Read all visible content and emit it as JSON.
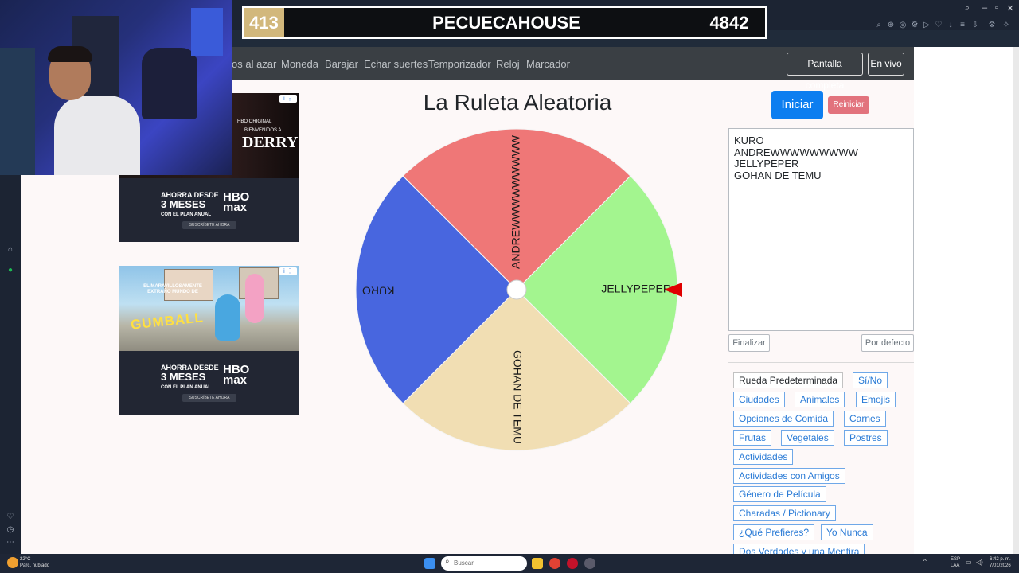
{
  "stream": {
    "score_left": "413",
    "channel_name": "PECUECAHOUSE",
    "score_right": "4842"
  },
  "nav": {
    "links": [
      "os al azar",
      "Moneda",
      "Barajar",
      "Echar suertes",
      "Temporizador",
      "Reloj",
      "Marcador"
    ],
    "fullscreen_label": "Pantalla completa",
    "live_label": "En vivo"
  },
  "main": {
    "title": "La Ruleta Aleatoria",
    "start_label": "Iniciar",
    "reset_label": "Reiniciar",
    "entries": [
      "KURO",
      "ANDREWWWWWWWWW",
      "JELLYPEPER",
      "GOHAN DE TEMU"
    ],
    "finish_label": "Finalizar",
    "default_label": "Por defecto"
  },
  "wheel": {
    "segments": [
      {
        "label": "ANDREWWWWWWWWW",
        "color": "#ef7777"
      },
      {
        "label": "JELLYPEPER",
        "color": "#a3f58f"
      },
      {
        "label": "GOHAN DE TEMU",
        "color": "#f1deb3"
      },
      {
        "label": "KURO",
        "color": "#4866df"
      }
    ],
    "pointer_color": "#e00000"
  },
  "presets": [
    "Rueda Predeterminada",
    "Sí/No",
    "Ciudades",
    "Animales",
    "Emojis",
    "Opciones de Comida",
    "Carnes",
    "Frutas",
    "Vegetales",
    "Postres",
    "Actividades",
    "Actividades con Amigos",
    "Género de Película",
    "Charadas / Pictionary",
    "¿Qué Prefieres?",
    "Yo Nunca",
    "Dos Verdades y una Mentira"
  ],
  "ads": {
    "hbo_original": "HBO ORIGINAL",
    "derry_line1": "BIENVENIDOS A",
    "derry_title": "DERRY",
    "gumball_line": "EL MARAVILLOSAMENTE EXTRAÑO MUNDO DE",
    "gumball_title": "GUMBALL",
    "promo_line1": "AHORRA DESDE",
    "promo_line2": "3 MESES",
    "promo_line3": "CON EL PLAN ANUAL",
    "promo_logo_top": "HBO",
    "promo_logo_bottom": "max",
    "promo_cta": "SUSCRÍBETE AHORA"
  },
  "taskbar": {
    "weather_temp": "22°C",
    "weather_desc": "Parc. nublado",
    "search_placeholder": "Buscar",
    "lang_top": "ESP",
    "lang_bottom": "LAA",
    "time": "6:42 p. m.",
    "date": "7/01/2026"
  },
  "colors": {
    "nav_bg": "#3a3f44",
    "primary": "#0d7ef0",
    "danger": "#e2737d",
    "score_gold": "#d2b87c"
  }
}
